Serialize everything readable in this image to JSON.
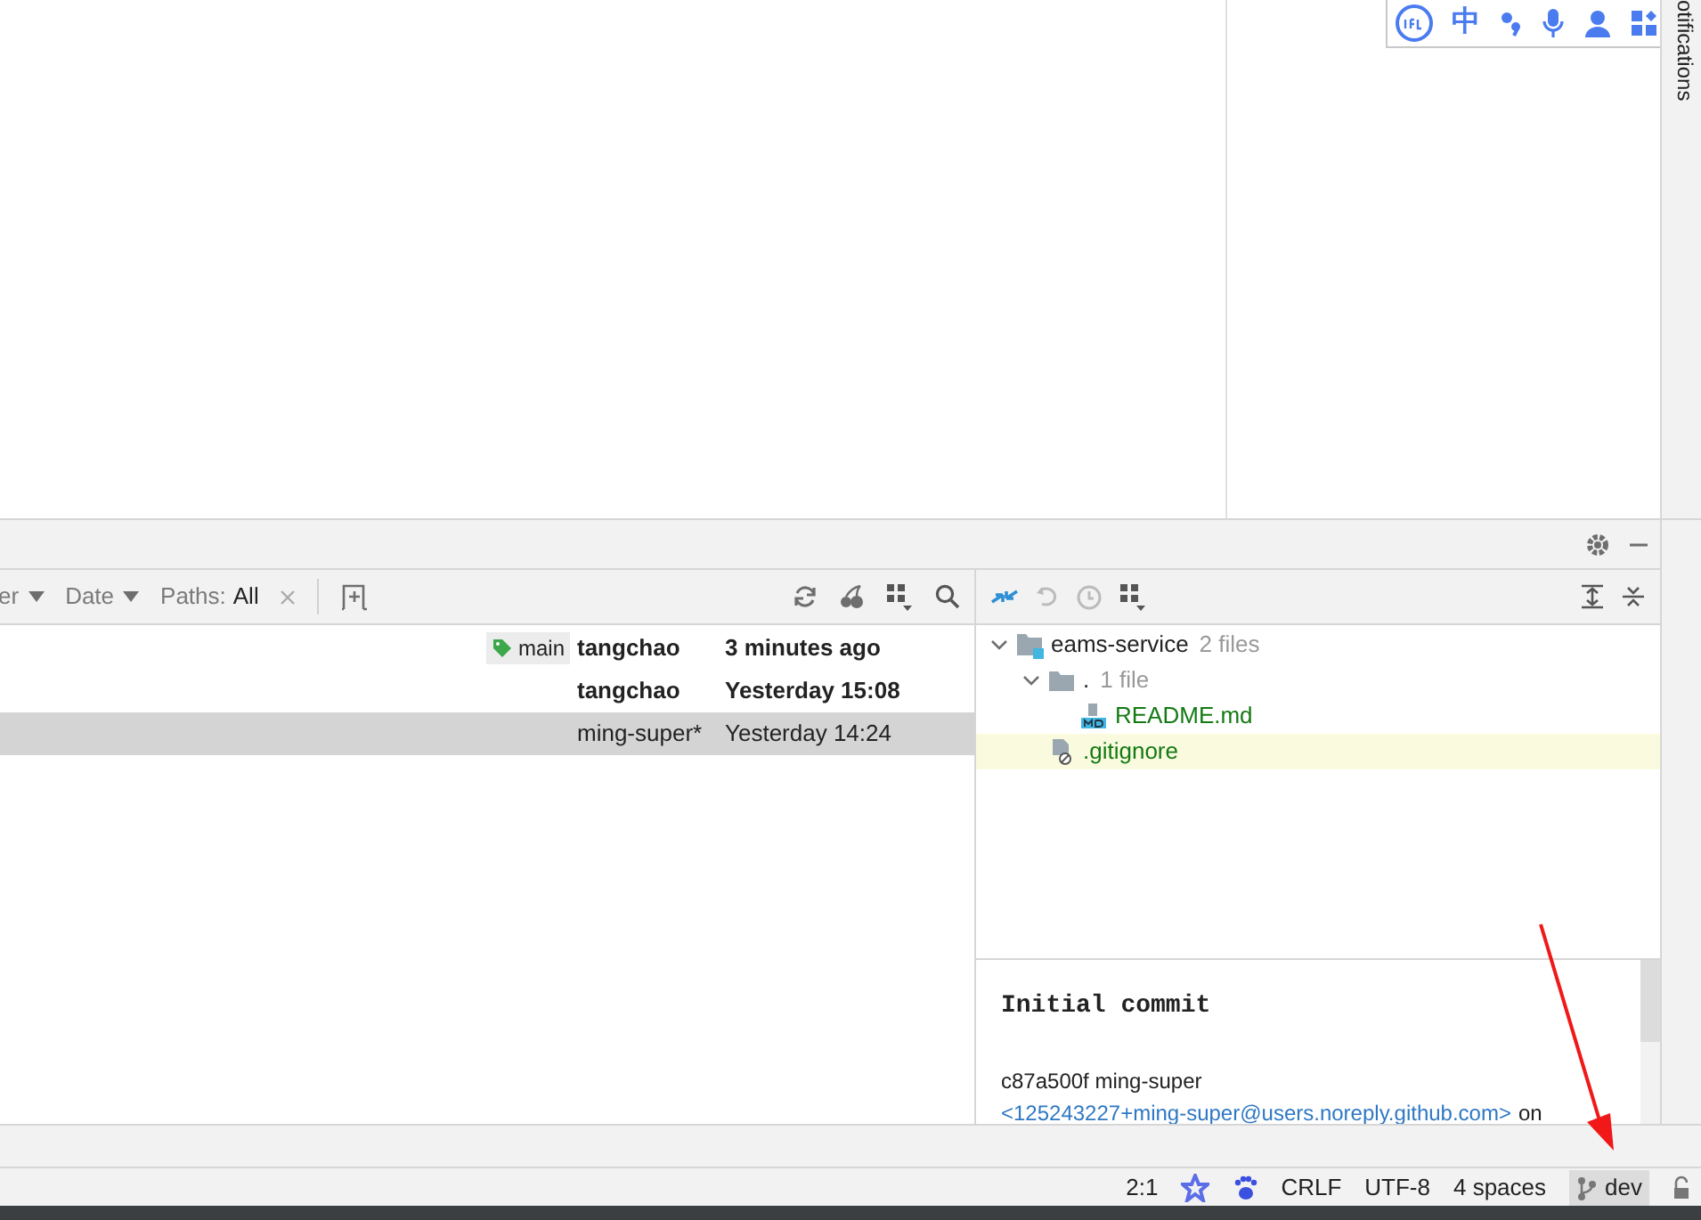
{
  "ime_toolbar": {
    "language": "中"
  },
  "notifications_tab": {
    "label": "otifications"
  },
  "log_toolbar": {
    "filters": [
      {
        "label": "er"
      },
      {
        "label": "Date"
      }
    ],
    "paths": {
      "label": "Paths:",
      "value": "All"
    }
  },
  "commits": [
    {
      "tag": "main",
      "author": "tangchao",
      "date": "3 minutes ago",
      "bold": true,
      "selected": false
    },
    {
      "author": "tangchao",
      "date": "Yesterday 15:08",
      "bold": true,
      "selected": false
    },
    {
      "author": "ming-super*",
      "date": "Yesterday 14:24",
      "bold": false,
      "selected": true
    }
  ],
  "changes_tree": [
    {
      "name": "eams-service",
      "count": "2 files",
      "kind": "module",
      "expanded": true,
      "children": [
        {
          "name": ".",
          "count": "1 file",
          "kind": "folder",
          "expanded": true,
          "children": [
            {
              "name": "README.md",
              "kind": "markdown",
              "selected": false
            }
          ]
        },
        {
          "name": ".gitignore",
          "kind": "ignore",
          "selected": true
        }
      ]
    }
  ],
  "commit_details": {
    "subject": "Initial commit",
    "hash_author": "c87a500f ming-super",
    "email": "<125243227+ming-super@users.noreply.github.com>",
    "suffix": "on"
  },
  "status_bar": {
    "position": "2:1",
    "line_separator": "CRLF",
    "encoding": "UTF-8",
    "indent": "4 spaces",
    "branch": "dev"
  }
}
